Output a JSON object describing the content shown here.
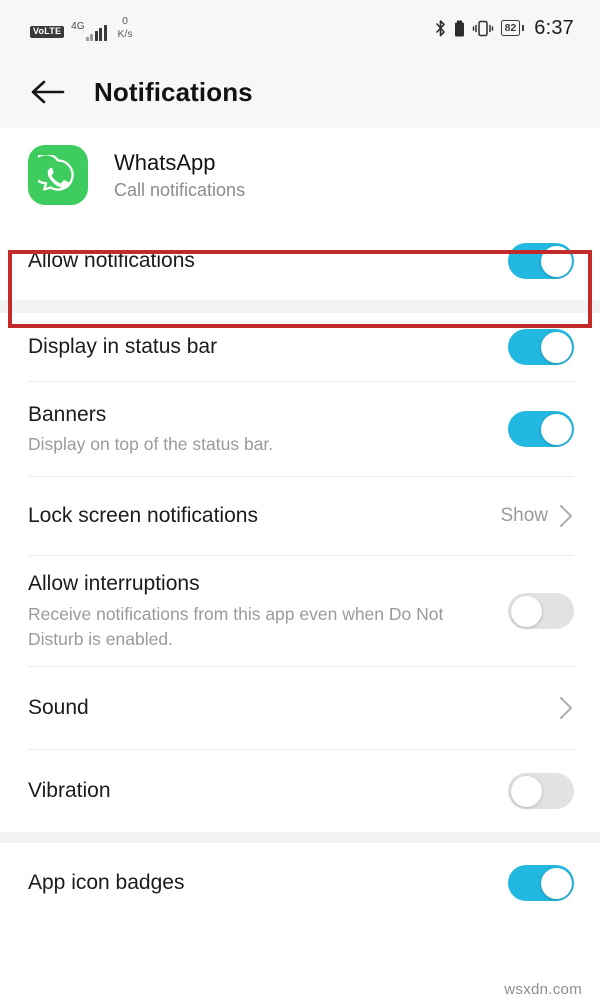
{
  "status_bar": {
    "volte": "VoLTE",
    "network_type": "4G",
    "speed_value": "0",
    "speed_unit": "K/s",
    "battery_percent": "82",
    "time": "6:37",
    "icons": [
      "bluetooth-icon",
      "battery-icon",
      "vibrate-icon"
    ]
  },
  "app_bar": {
    "title": "Notifications",
    "back_icon": "back-arrow-icon"
  },
  "app_header": {
    "name": "WhatsApp",
    "channel": "Call notifications",
    "icon": "whatsapp-icon",
    "icon_color": "#3ECC5F"
  },
  "highlight": {
    "color": "#C32A2C",
    "target": "Allow notifications"
  },
  "accent_color": "#23B8E0",
  "settings": [
    {
      "title": "Allow notifications",
      "desc": "",
      "control": "toggle",
      "state": "on"
    },
    {
      "title": "Display in status bar",
      "desc": "",
      "control": "toggle",
      "state": "on"
    },
    {
      "title": "Banners",
      "desc": "Display on top of the status bar.",
      "control": "toggle",
      "state": "on"
    },
    {
      "title": "Lock screen notifications",
      "desc": "",
      "control": "value-chevron",
      "value": "Show"
    },
    {
      "title": "Allow interruptions",
      "desc": "Receive notifications from this app even when Do Not Disturb is enabled.",
      "control": "toggle",
      "state": "off"
    },
    {
      "title": "Sound",
      "desc": "",
      "control": "chevron",
      "value": ""
    },
    {
      "title": "Vibration",
      "desc": "",
      "control": "toggle",
      "state": "off"
    },
    {
      "title": "App icon badges",
      "desc": "",
      "control": "toggle",
      "state": "on"
    }
  ],
  "watermark": "wsxdn.com"
}
